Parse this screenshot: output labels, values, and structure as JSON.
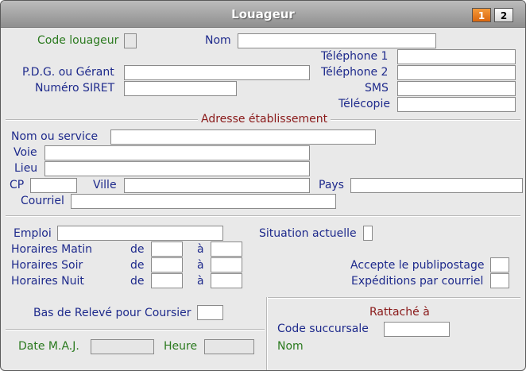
{
  "window": {
    "title": "Louageur",
    "pages": [
      "1",
      "2"
    ]
  },
  "labels": {
    "code_louageur": "Code louageur",
    "nom": "Nom",
    "telephone1": "Téléphone 1",
    "telephone2": "Téléphone 2",
    "pdg": "P.D.G. ou Gérant",
    "siret": "Numéro SIRET",
    "sms": "SMS",
    "telecopie": "Télécopie",
    "adresse_section": "Adresse établissement",
    "nom_service": "Nom ou service",
    "voie": "Voie",
    "lieu": "Lieu",
    "cp": "CP",
    "ville": "Ville",
    "pays": "Pays",
    "courriel": "Courriel",
    "emploi": "Emploi",
    "situation": "Situation actuelle",
    "horaires_matin": "Horaires Matin",
    "horaires_soir": "Horaires Soir",
    "horaires_nuit": "Horaires Nuit",
    "de": "de",
    "a": "à",
    "publipostage": "Accepte le publipostage",
    "expeditions": "Expéditions par courriel",
    "bas_releve": "Bas de Relevé pour Coursier",
    "rattache": "Rattaché à",
    "code_succursale": "Code succursale",
    "nom_succursale": "Nom",
    "date_maj": "Date M.A.J.",
    "heure": "Heure"
  }
}
